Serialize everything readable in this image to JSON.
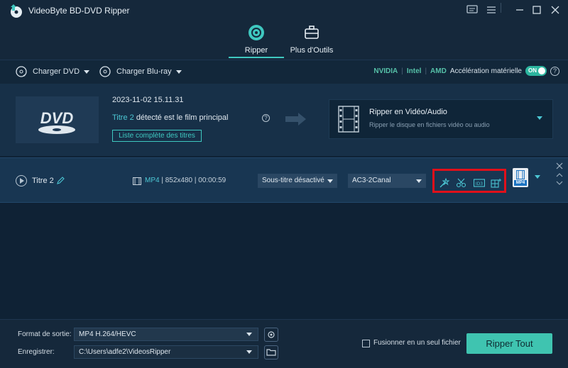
{
  "app": {
    "title": "VideoByte BD-DVD Ripper"
  },
  "tabs": [
    {
      "label": "Ripper",
      "icon": "disc-rip-icon",
      "active": true
    },
    {
      "label": "Plus d'Outils",
      "icon": "toolbox-icon",
      "active": false
    }
  ],
  "toolbar": {
    "load_dvd": "Charger DVD",
    "load_bluray": "Charger Blu-ray",
    "brand_nvidia": "NVIDIA",
    "brand_intel": "Intel",
    "brand_amd": "AMD",
    "accel_label": "Accélération matérielle",
    "toggle_state": "ON",
    "separator": "|"
  },
  "source": {
    "thumb_label": "DVD",
    "date": "2023-11-02 15.11.31",
    "title_highlight": "Titre 2",
    "title_detected": "détecté est le film principal",
    "title_list_button": "Liste complète des titres",
    "rip_mode_title": "Ripper en Vidéo/Audio",
    "rip_mode_sub": "Ripper le disque en fichiers vidéo ou audio"
  },
  "title_row": {
    "name": "Titre 2",
    "format": "MP4",
    "resolution": "852x480",
    "duration": "00:00:59",
    "meta_sep": "|",
    "subtitle": "Sous-titre désactivé",
    "audio": "AC3-2Canal",
    "output_badge": "MP4"
  },
  "bottom": {
    "format_label": "Format de sortie:",
    "format_value": "MP4 H.264/HEVC",
    "save_label": "Enregistrer:",
    "save_path": "C:\\Users\\adfe2\\VideosRipper",
    "merge_label": "Fusionner en un seul fichier",
    "rip_all": "Ripper Tout"
  },
  "colors": {
    "accent": "#3fc8c0",
    "highlight_box": "#e0101a",
    "background": "#0f2235"
  }
}
